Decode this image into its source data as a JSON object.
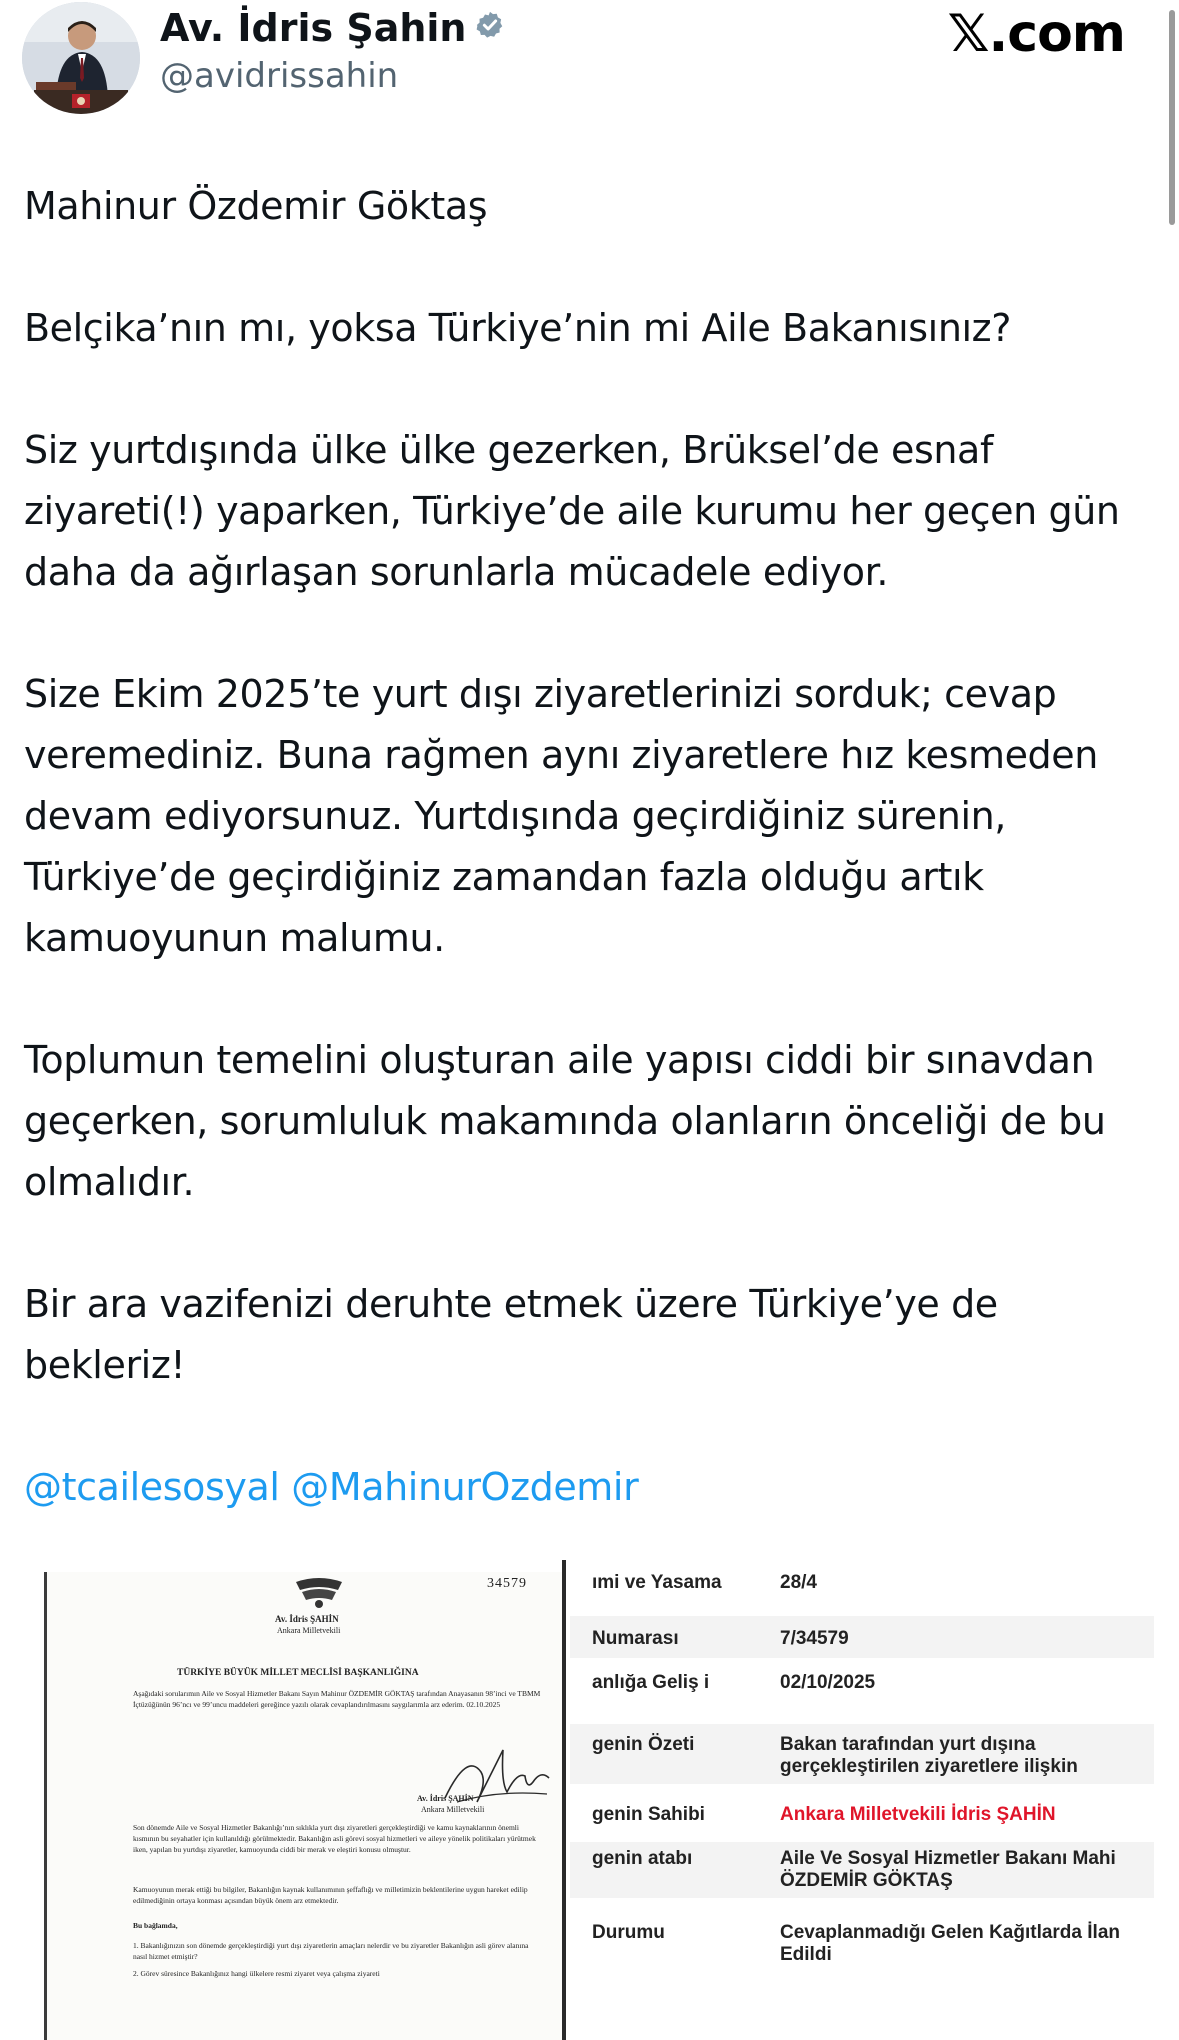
{
  "header": {
    "author_name": "Av. İdris Şahin",
    "handle": "@avidrissahin",
    "site": "𝕏.com"
  },
  "tweet": {
    "paragraphs": [
      "Mahinur Özdemir Göktaş",
      "Belçika’nın mı, yoksa Türkiye’nin mi Aile Bakanısınız?",
      "Siz yurtdışında ülke ülke gezerken, Brüksel’de esnaf ziyareti(!) yaparken, Türkiye’de aile kurumu her geçen gün daha da ağırlaşan sorunlarla mücadele ediyor.",
      "Size Ekim 2025’te yurt dışı ziyaretlerinizi sorduk; cevap veremediniz. Buna rağmen aynı ziyaretlere hız kesmeden devam ediyorsunuz. Yurtdışında geçirdiğiniz sürenin, Türkiye’de geçirdiğiniz zamandan fazla olduğu artık kamuoyunun malumu.",
      "Toplumun temelini oluşturan aile yapısı ciddi bir sınavdan geçerken, sorumluluk makamında olanların önceliği de bu olmalıdır.",
      "Bir ara vazifenizi deruhte etmek üzere Türkiye’ye de bekleriz!"
    ],
    "mentions": [
      "@tcailesosyal",
      "@MahinurOzdemir"
    ]
  },
  "document": {
    "number": "34579",
    "author": "Av. İdris ŞAHİN",
    "role": "Ankara Milletvekili",
    "heading": "TÜRKİYE BÜYÜK MİLLET MECLİSİ BAŞKANLIĞINA",
    "intro": "Aşağıdaki sorularımın Aile ve Sosyal Hizmetler Bakanı Sayın Mahinur ÖZDEMİR GÖKTAŞ tarafından Anayasanın 98’inci ve TBMM İçtüzüğünün 96’ncı ve 99’uncu maddeleri gereğince yazılı olarak cevaplandırılmasını saygılarımla arz ederim. 02.10.2025",
    "sign_name": "Av. İdris ŞAHİN",
    "sign_role": "Ankara Milletvekili",
    "body": "Son dönemde Aile ve Sosyal Hizmetler Bakanlığı’nın sıklıkla yurt dışı ziyaretleri gerçekleştirdiği ve kamu kaynaklarının önemli kısmının bu seyahatler için kullanıldığı görülmektedir. Bakanlığın asli görevi sosyal hizmetleri ve aileye yönelik politikaları yürütmek iken, yapılan bu yurtdışı ziyaretler, kamuoyunda ciddi bir merak ve eleştiri konusu olmuştur.",
    "body2": "Kamuoyunun merak ettiği bu bilgiler, Bakanlığın kaynak kullanımının şeffaflığı ve milletimizin beklentilerine uygun hareket edilip edilmediğinin ortaya konması açısından büyük önem arz etmektedir.",
    "bu_baglamda": "Bu bağlamda,",
    "q1": "1.   Bakanlığınızın son dönemde gerçekleştirdiği yurt dışı ziyaretlerin amaçları nelerdir ve bu ziyaretler Bakanlığın asli görev alanına nasıl hizmet etmiştir?",
    "q2": "2.   Görev süresince Bakanlığınız hangi ülkelere resmi ziyaret veya çalışma ziyareti"
  },
  "record": {
    "rows": [
      {
        "key": "ımi ve Yasama",
        "value": "28/4"
      },
      {
        "key": "Numarası",
        "value": "7/34579"
      },
      {
        "key": "anlığa Geliş\ni",
        "value": "02/10/2025"
      },
      {
        "key": "genin Özeti",
        "value": "Bakan tarafından yurt dışına\ngerçekleştirilen ziyaretlere ilişkin"
      },
      {
        "key": "genin Sahibi",
        "value": "Ankara Milletvekili İdris ŞAHİN"
      },
      {
        "key": "genin\natabı",
        "value": "Aile Ve Sosyal Hizmetler Bakanı Mahi\nÖZDEMİR GÖKTAŞ"
      },
      {
        "key": "Durumu",
        "value": "Cevaplanmadığı Gelen Kağıtlarda İlan\nEdildi"
      }
    ]
  },
  "colors": {
    "text": "#0f1419",
    "secondary": "#536471",
    "link": "#1d9bf0",
    "verified": "#829aab",
    "alert_red": "#e0152a"
  }
}
